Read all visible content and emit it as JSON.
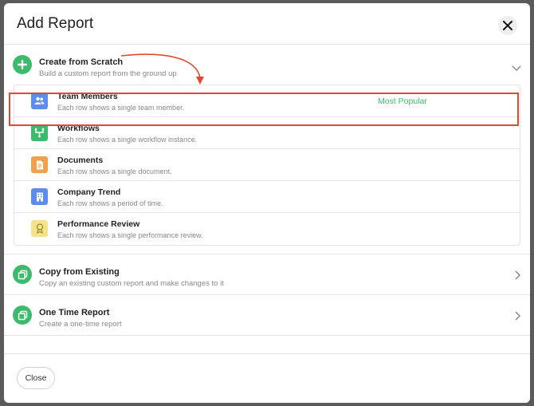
{
  "modal": {
    "title": "Add Report",
    "close_label": "Close"
  },
  "create_section": {
    "title": "Create from Scratch",
    "description": "Build a custom report from the ground up",
    "items": [
      {
        "title": "Team Members",
        "description": "Each row shows a single team member.",
        "badge": "Most Popular",
        "icon": "people-icon",
        "color": "#5b8def"
      },
      {
        "title": "Workflows",
        "description": "Each row shows a single workflow instance.",
        "icon": "workflow-icon",
        "color": "#3dbb6c"
      },
      {
        "title": "Documents",
        "description": "Each row shows a single document.",
        "icon": "document-icon",
        "color": "#f0a24a"
      },
      {
        "title": "Company Trend",
        "description": "Each row shows a period of time.",
        "icon": "building-icon",
        "color": "#5b8def"
      },
      {
        "title": "Performance Review",
        "description": "Each row shows a single performance review.",
        "icon": "award-icon",
        "color": "#f3e38a"
      }
    ]
  },
  "copy_section": {
    "title": "Copy from Existing",
    "description": "Copy an existing custom report and make changes to it"
  },
  "onetime_section": {
    "title": "One Time Report",
    "description": "Create a one-time report"
  },
  "colors": {
    "accent_green": "#3dbb6c",
    "highlight_red": "#e04b30"
  }
}
